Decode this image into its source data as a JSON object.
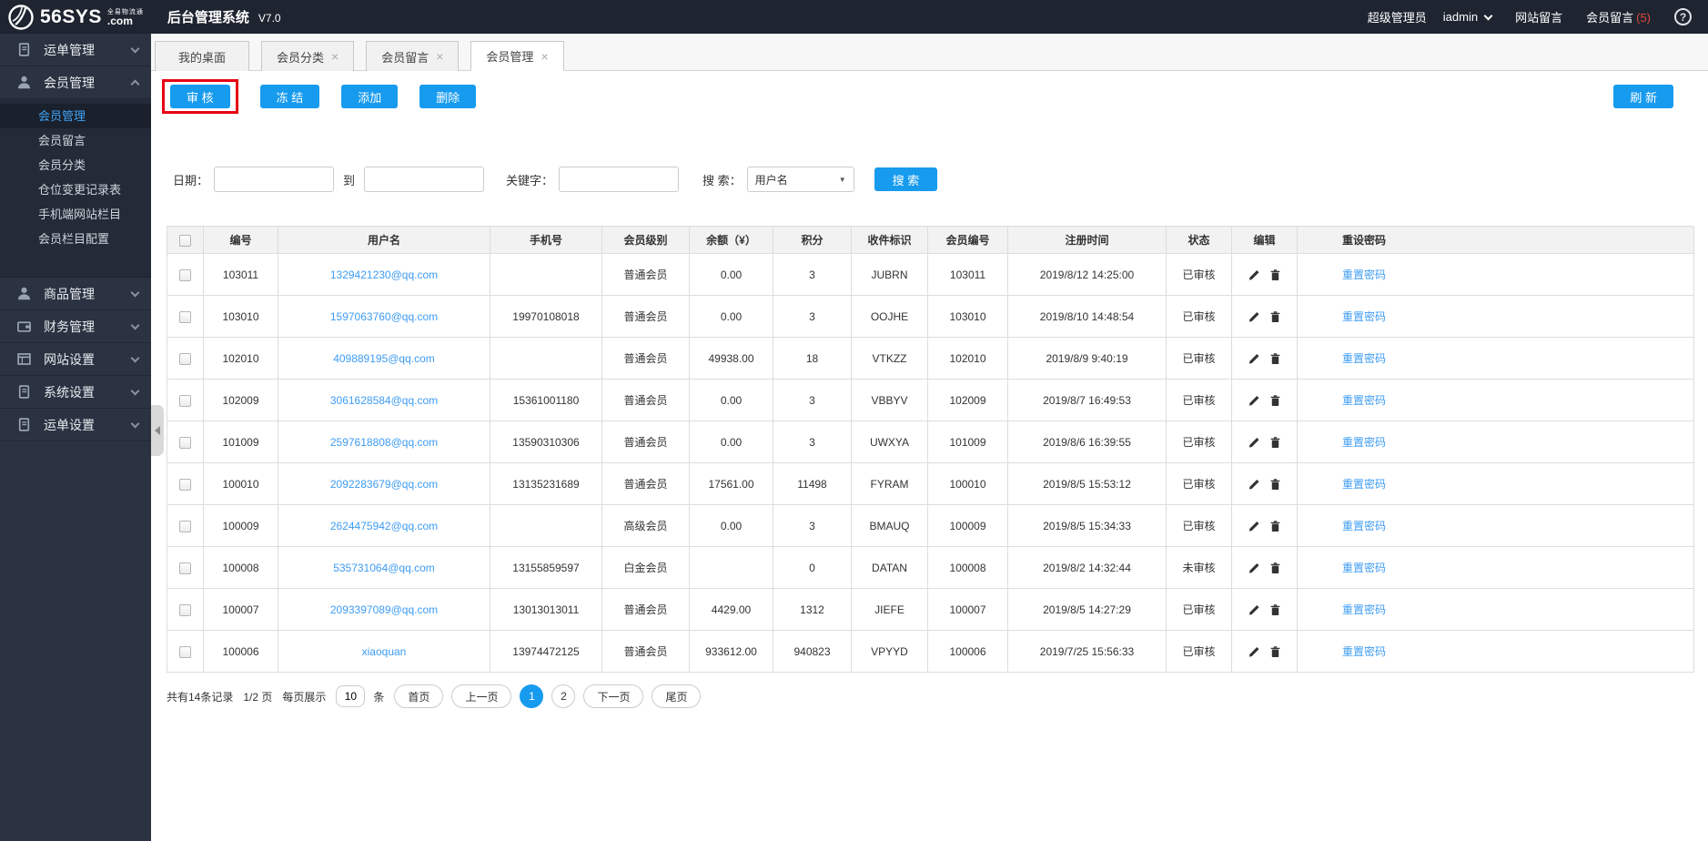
{
  "header": {
    "brand_name": "56SYS",
    "brand_tld": ".com",
    "brand_tagline": "全易物流通",
    "sys_title": "后台管理系统",
    "version": "V7.0",
    "role": "超级管理员",
    "username": "iadmin",
    "site_messages": "网站留言",
    "member_messages": "会员留言",
    "member_messages_count": "(5)",
    "help": "?"
  },
  "colors": {
    "accent_blue": "#179bee",
    "link_blue": "#3e9cf3",
    "active_nav_blue": "#3fa2f5",
    "alert_red": "#e0483e",
    "highlight_red": "#e60012",
    "header_bg": "#1e2430",
    "sidebar_bg": "#2b3342"
  },
  "sidebar": {
    "sections": [
      {
        "label": "运单管理",
        "icon": "document",
        "expanded": false
      },
      {
        "label": "会员管理",
        "icon": "user",
        "expanded": true,
        "children": [
          {
            "label": "会员管理",
            "active": true
          },
          {
            "label": "会员留言",
            "active": false
          },
          {
            "label": "会员分类",
            "active": false
          },
          {
            "label": "仓位变更记录表",
            "active": false
          },
          {
            "label": "手机端网站栏目",
            "active": false
          },
          {
            "label": "会员栏目配置",
            "active": false
          }
        ]
      },
      {
        "label": "商品管理",
        "icon": "user",
        "expanded": false
      },
      {
        "label": "财务管理",
        "icon": "wallet",
        "expanded": false
      },
      {
        "label": "网站设置",
        "icon": "window",
        "expanded": false
      },
      {
        "label": "系统设置",
        "icon": "document",
        "expanded": false
      },
      {
        "label": "运单设置",
        "icon": "document",
        "expanded": false
      }
    ]
  },
  "tabs": [
    {
      "label": "我的桌面",
      "closable": false,
      "active": false
    },
    {
      "label": "会员分类",
      "closable": true,
      "active": false
    },
    {
      "label": "会员留言",
      "closable": true,
      "active": false
    },
    {
      "label": "会员管理",
      "closable": true,
      "active": true
    }
  ],
  "toolbar": {
    "audit": "审 核",
    "freeze": "冻 结",
    "add": "添加",
    "delete": "删除",
    "refresh": "刷 新"
  },
  "filters": {
    "date_label": "日期：",
    "to_label": "到",
    "keyword_label": "关键字：",
    "search_label": "搜 索：",
    "search_type_selected": "用户名",
    "search_button": "搜 索"
  },
  "table": {
    "headers": [
      "编号",
      "用户名",
      "手机号",
      "会员级别",
      "余额（¥）",
      "积分",
      "收件标识",
      "会员编号",
      "注册时间",
      "状态",
      "编辑",
      "重设密码"
    ],
    "reset_link": "重置密码",
    "edit_icons": [
      "pencil-icon",
      "trash-icon"
    ],
    "rows": [
      {
        "id": "103011",
        "username": "1329421230@qq.com",
        "phone": "",
        "level": "普通会员",
        "balance": "0.00",
        "points": "3",
        "code": "JUBRN",
        "member_no": "103011",
        "reg_time": "2019/8/12 14:25:00",
        "status": "已审核"
      },
      {
        "id": "103010",
        "username": "1597063760@qq.com",
        "phone": "19970108018",
        "level": "普通会员",
        "balance": "0.00",
        "points": "3",
        "code": "OOJHE",
        "member_no": "103010",
        "reg_time": "2019/8/10 14:48:54",
        "status": "已审核"
      },
      {
        "id": "102010",
        "username": "409889195@qq.com",
        "phone": "",
        "level": "普通会员",
        "balance": "49938.00",
        "points": "18",
        "code": "VTKZZ",
        "member_no": "102010",
        "reg_time": "2019/8/9 9:40:19",
        "status": "已审核"
      },
      {
        "id": "102009",
        "username": "3061628584@qq.com",
        "phone": "15361001180",
        "level": "普通会员",
        "balance": "0.00",
        "points": "3",
        "code": "VBBYV",
        "member_no": "102009",
        "reg_time": "2019/8/7 16:49:53",
        "status": "已审核"
      },
      {
        "id": "101009",
        "username": "2597618808@qq.com",
        "phone": "13590310306",
        "level": "普通会员",
        "balance": "0.00",
        "points": "3",
        "code": "UWXYA",
        "member_no": "101009",
        "reg_time": "2019/8/6 16:39:55",
        "status": "已审核"
      },
      {
        "id": "100010",
        "username": "2092283679@qq.com",
        "phone": "13135231689",
        "level": "普通会员",
        "balance": "17561.00",
        "points": "11498",
        "code": "FYRAM",
        "member_no": "100010",
        "reg_time": "2019/8/5 15:53:12",
        "status": "已审核"
      },
      {
        "id": "100009",
        "username": "2624475942@qq.com",
        "phone": "",
        "level": "高级会员",
        "balance": "0.00",
        "points": "3",
        "code": "BMAUQ",
        "member_no": "100009",
        "reg_time": "2019/8/5 15:34:33",
        "status": "已审核"
      },
      {
        "id": "100008",
        "username": "535731064@qq.com",
        "phone": "13155859597",
        "level": "白金会员",
        "balance": "",
        "points": "0",
        "code": "DATAN",
        "member_no": "100008",
        "reg_time": "2019/8/2 14:32:44",
        "status": "未审核"
      },
      {
        "id": "100007",
        "username": "2093397089@qq.com",
        "phone": "13013013011",
        "level": "普通会员",
        "balance": "4429.00",
        "points": "1312",
        "code": "JIEFE",
        "member_no": "100007",
        "reg_time": "2019/8/5 14:27:29",
        "status": "已审核"
      },
      {
        "id": "100006",
        "username": "xiaoquan",
        "phone": "13974472125",
        "level": "普通会员",
        "balance": "933612.00",
        "points": "940823",
        "code": "VPYYD",
        "member_no": "100006",
        "reg_time": "2019/7/25 15:56:33",
        "status": "已审核"
      }
    ]
  },
  "pagination": {
    "total": "共有14条记录",
    "page_info": "1/2 页",
    "per_page_label": "每页展示",
    "per_page": "10",
    "unit_label": "条",
    "first": "首页",
    "prev": "上一页",
    "pages": [
      "1",
      "2"
    ],
    "active_page": "1",
    "next": "下一页",
    "last": "尾页"
  }
}
